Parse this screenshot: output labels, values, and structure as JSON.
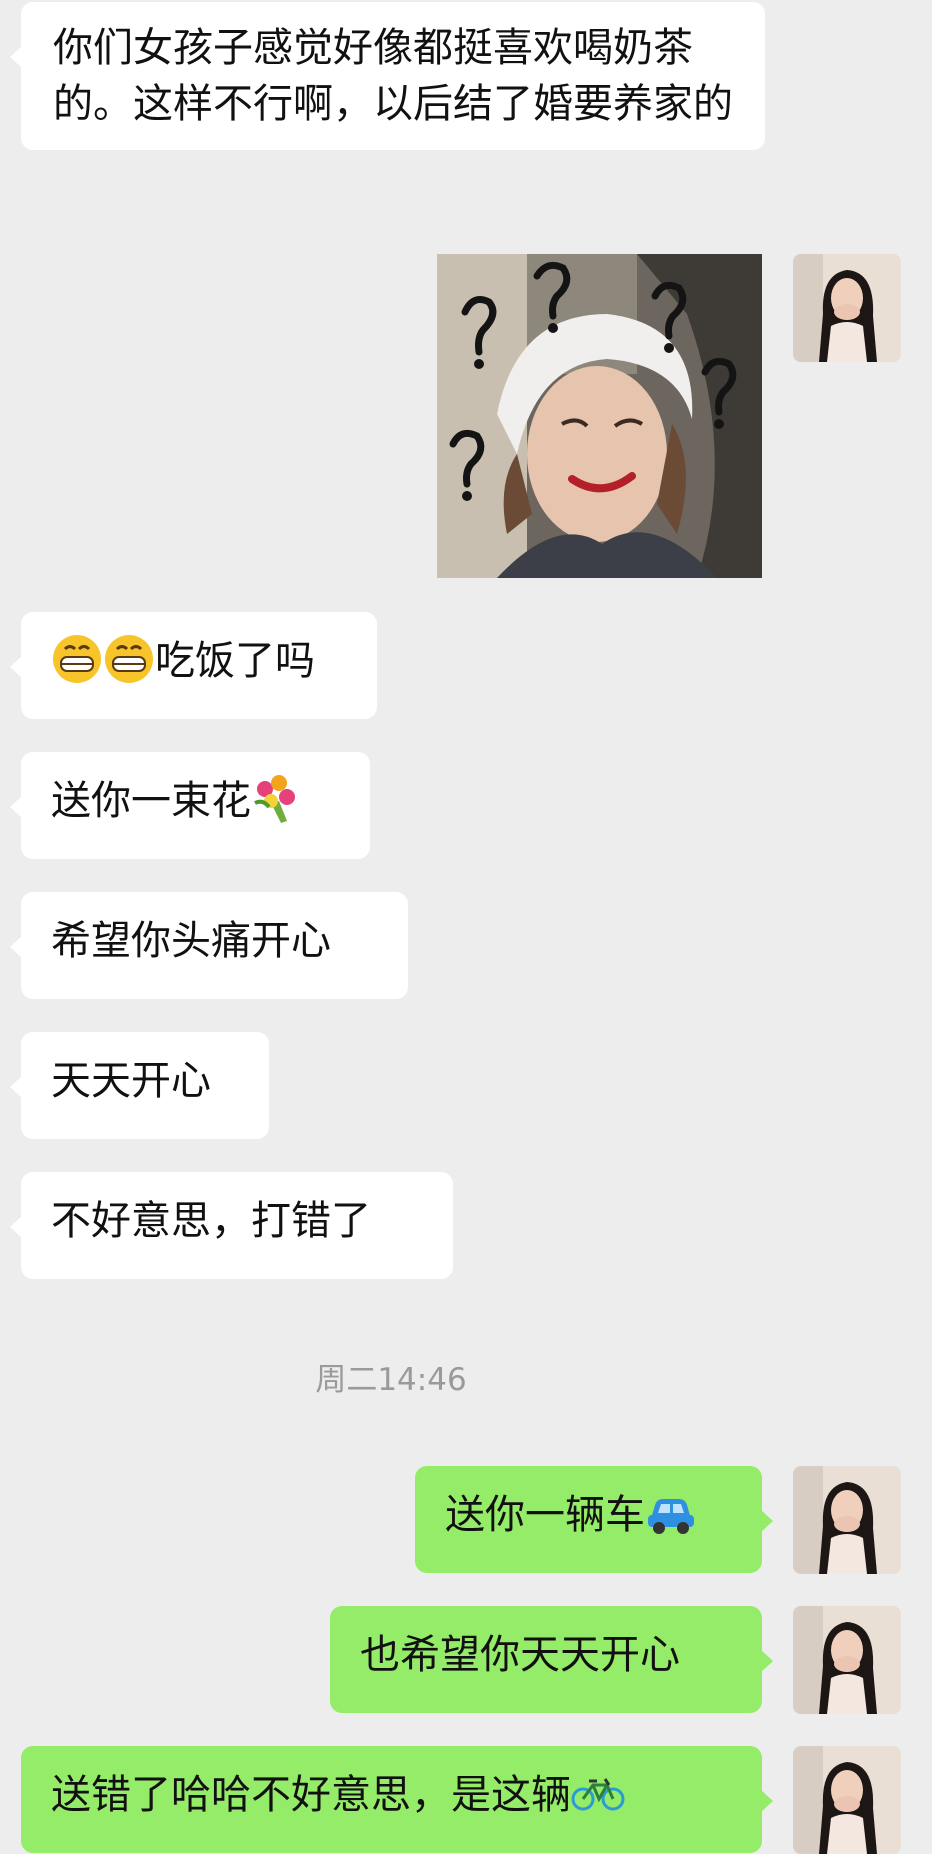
{
  "messages": [
    {
      "side": "in",
      "text": "你们女孩子感觉好像都挺喜欢喝奶茶的。这样不行啊，以后结了婚要养家的"
    },
    {
      "side": "out",
      "type": "sticker",
      "icon": "question-marks-sticker"
    },
    {
      "side": "in",
      "text": "吃饭了吗",
      "prefix_icon": "grinning-face-emoji-x2"
    },
    {
      "side": "in",
      "text": "送你一束花",
      "suffix_icon": "bouquet-emoji"
    },
    {
      "side": "in",
      "text": "希望你头痛开心"
    },
    {
      "side": "in",
      "text": "天天开心"
    },
    {
      "side": "in",
      "text": "不好意思，打错了"
    },
    {
      "side": "out",
      "text": "送你一辆车",
      "suffix_icon": "car-emoji"
    },
    {
      "side": "out",
      "text": "也希望你天天开心"
    },
    {
      "side": "out",
      "text": "送错了哈哈不好意思，是这辆",
      "suffix_icon": "bicycle-emoji"
    }
  ],
  "timestamp": "周二14:46",
  "colors": {
    "background": "#ededed",
    "incoming_bubble": "#ffffff",
    "outgoing_bubble": "#95ec69",
    "timestamp_text": "#9a9a9a"
  }
}
